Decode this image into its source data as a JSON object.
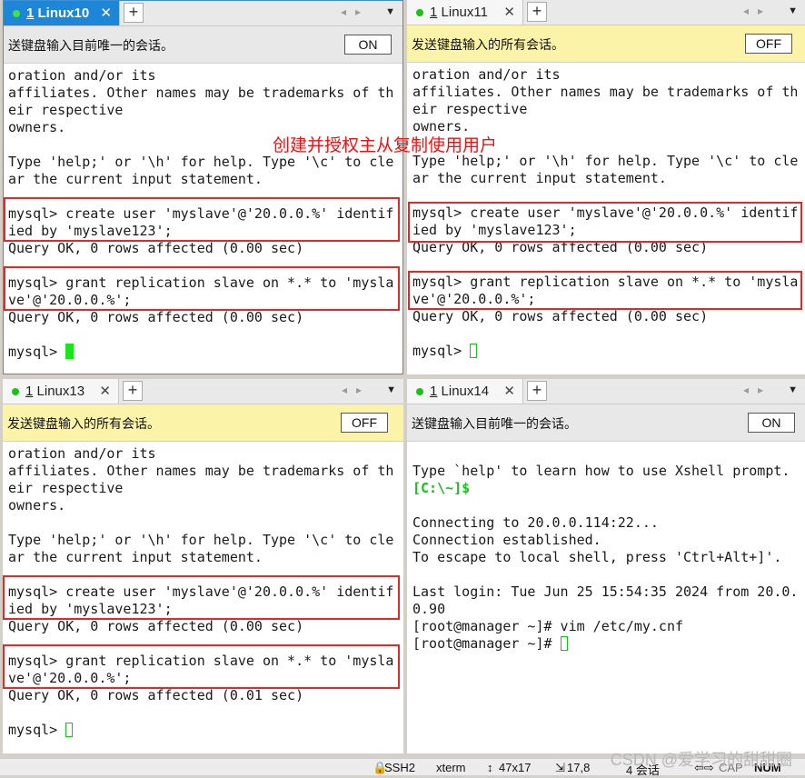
{
  "annotation": "创建并授权主从复制使用用户",
  "panes": [
    {
      "tab": {
        "number": "1",
        "name": "Linux10",
        "close": "✕"
      },
      "add_tab": "+",
      "send_text": "送键盘输入目前唯一的会话。",
      "toggle": "ON",
      "lines": [
        "oration and/or its",
        "affiliates. Other names may be trademarks of th",
        "eir respective",
        "owners.",
        "",
        "Type 'help;' or '\\h' for help. Type '\\c' to cle",
        "ar the current input statement.",
        "",
        "mysql> create user 'myslave'@'20.0.0.%' identif",
        "ied by 'myslave123';",
        "Query OK, 0 rows affected (0.00 sec)",
        "",
        "mysql> grant replication slave on *.* to 'mysla",
        "ve'@'20.0.0.%';",
        "Query OK, 0 rows affected (0.00 sec)",
        "",
        "mysql> "
      ]
    },
    {
      "tab": {
        "number": "1",
        "name": "Linux11",
        "close": "✕"
      },
      "add_tab": "+",
      "send_text": "发送键盘输入的所有会话。",
      "toggle": "OFF",
      "lines": [
        "oration and/or its",
        "affiliates. Other names may be trademarks of th",
        "eir respective",
        "owners.",
        "",
        "Type 'help;' or '\\h' for help. Type '\\c' to cle",
        "ar the current input statement.",
        "",
        "mysql> create user 'myslave'@'20.0.0.%' identif",
        "ied by 'myslave123';",
        "Query OK, 0 rows affected (0.00 sec)",
        "",
        "mysql> grant replication slave on *.* to 'mysla",
        "ve'@'20.0.0.%';",
        "Query OK, 0 rows affected (0.00 sec)",
        "",
        "mysql> "
      ]
    },
    {
      "tab": {
        "number": "1",
        "name": "Linux13",
        "close": "✕"
      },
      "add_tab": "+",
      "send_text": "发送键盘输入的所有会话。",
      "toggle": "OFF",
      "lines": [
        "oration and/or its",
        "affiliates. Other names may be trademarks of th",
        "eir respective",
        "owners.",
        "",
        "Type 'help;' or '\\h' for help. Type '\\c' to cle",
        "ar the current input statement.",
        "",
        "mysql> create user 'myslave'@'20.0.0.%' identif",
        "ied by 'myslave123';",
        "Query OK, 0 rows affected (0.00 sec)",
        "",
        "mysql> grant replication slave on *.* to 'mysla",
        "ve'@'20.0.0.%';",
        "Query OK, 0 rows affected (0.01 sec)",
        "",
        "mysql> "
      ]
    },
    {
      "tab": {
        "number": "1",
        "name": "Linux14",
        "close": "✕"
      },
      "add_tab": "+",
      "send_text": "送键盘输入目前唯一的会话。",
      "toggle": "ON",
      "lines": [
        "",
        "Type `help' to learn how to use Xshell prompt.",
        "[C:\\~]$",
        "",
        "Connecting to 20.0.0.114:22...",
        "Connection established.",
        "To escape to local shell, press 'Ctrl+Alt+]'.",
        "",
        "Last login: Tue Jun 25 15:54:35 2024 from 20.0.",
        "0.90",
        "[root@manager ~]# vim /etc/my.cnf",
        "[root@manager ~]# "
      ]
    }
  ],
  "statusbar": {
    "ssh": "SSH2",
    "term": "xterm",
    "size": "47x17",
    "pos": "17,8",
    "sessions": "4 会话",
    "cap": "CAP",
    "num": "NUM"
  },
  "watermark": "CSDN @爱学习的甜甜圈"
}
